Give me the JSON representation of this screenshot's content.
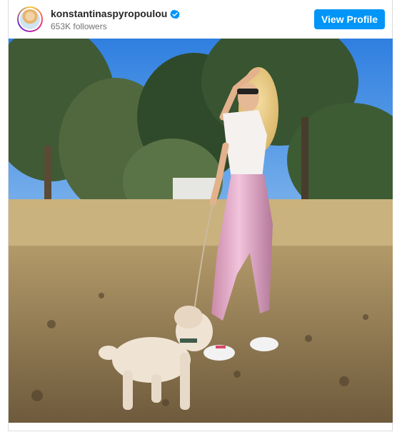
{
  "post": {
    "username": "konstantinaspyropoulou",
    "followers": "653K followers",
    "view_profile_label": "View Profile"
  },
  "colors": {
    "button": "#0095f6",
    "verified": "#0095f6",
    "username": "#262626",
    "muted": "#737373"
  },
  "icons": {
    "verified": "verified-badge-icon",
    "avatar": "profile-avatar"
  },
  "photo": {
    "description_visible": false
  }
}
